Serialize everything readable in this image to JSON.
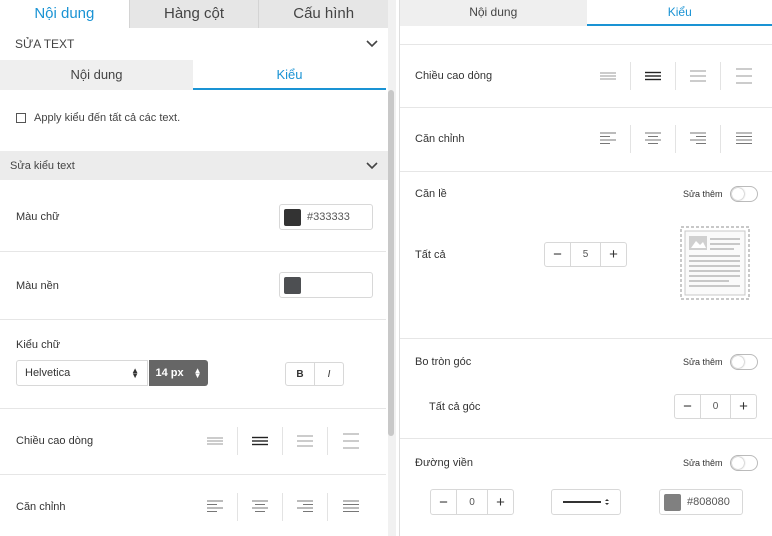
{
  "left": {
    "top_tabs": [
      "Nội dung",
      "Hàng cột",
      "Cấu hình"
    ],
    "sua_text": "SỬA TEXT",
    "sub_tabs": [
      "Nội dung",
      "Kiểu"
    ],
    "apply_label": "Apply kiểu đến tất cả các text.",
    "section_title": "Sửa kiểu text",
    "text_color": {
      "label": "Màu chữ",
      "value": "#333333",
      "swatch": "#333333"
    },
    "bg_color": {
      "label": "Màu nền",
      "value": "",
      "swatch": "#4d4f52"
    },
    "font": {
      "label": "Kiểu chữ",
      "family": "Helvetica",
      "size": "14 px",
      "bold": "B",
      "italic": "I"
    },
    "line_height_label": "Chiều cao dòng",
    "align_label": "Căn chỉnh"
  },
  "right": {
    "tabs": [
      "Nội dung",
      "Kiểu"
    ],
    "line_height_label": "Chiều cao dòng",
    "align_label": "Căn chỉnh",
    "margin": {
      "label": "Căn lề",
      "more": "Sửa thêm",
      "all_label": "Tất cả",
      "all_value": "5"
    },
    "radius": {
      "label": "Bo tròn góc",
      "more": "Sửa thêm",
      "all_label": "Tất cả góc",
      "all_value": "0"
    },
    "border": {
      "label": "Đường viền",
      "more": "Sửa thêm",
      "width_value": "0",
      "color": "#808080",
      "swatch": "#808080"
    }
  },
  "colors": {
    "accent": "#1a93d4"
  },
  "icons": [
    "chevron-down-icon",
    "line-height-icons",
    "align-icons",
    "plus-icon",
    "minus-icon",
    "layout-preview-icon"
  ]
}
